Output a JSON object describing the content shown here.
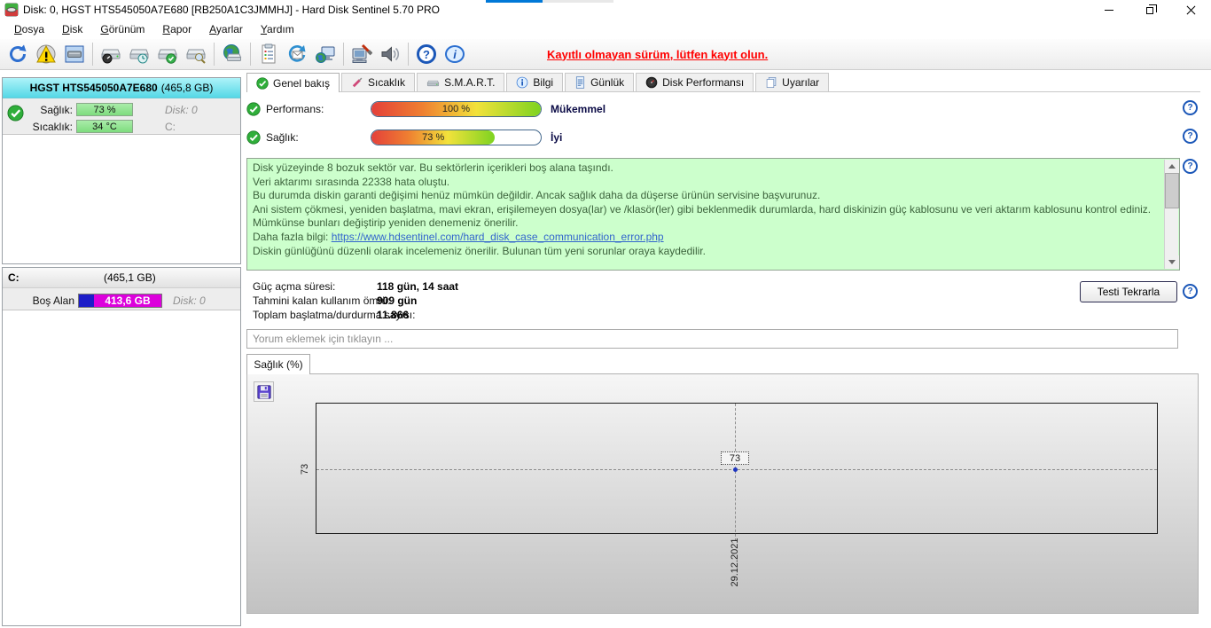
{
  "window": {
    "title": "Disk: 0, HGST HTS545050A7E680 [RB250A1C3JMMHJ]  -  Hard Disk Sentinel 5.70 PRO"
  },
  "menu": {
    "items": [
      "Dosya",
      "Disk",
      "Görünüm",
      "Rapor",
      "Ayarlar",
      "Yardım"
    ]
  },
  "toolbar": {
    "register_notice": "Kayıtlı olmayan sürüm, lütfen kayıt olun.",
    "icons": [
      "refresh",
      "warning-report",
      "disk-panel",
      "disk-gauge",
      "disk-clock",
      "disk-test",
      "disk-search",
      "web-disk",
      "report",
      "send-report",
      "network-remote",
      "remote-config",
      "sound",
      "help",
      "info"
    ]
  },
  "icons": {
    "help_glyph": "?",
    "info_glyph": "i"
  },
  "tabs": [
    {
      "label": "Genel bakış",
      "active": true
    },
    {
      "label": "Sıcaklık",
      "active": false
    },
    {
      "label": "S.M.A.R.T.",
      "active": false
    },
    {
      "label": "Bilgi",
      "active": false
    },
    {
      "label": "Günlük",
      "active": false
    },
    {
      "label": "Disk Performansı",
      "active": false
    },
    {
      "label": "Uyarılar",
      "active": false
    }
  ],
  "sidebar": {
    "disk": {
      "model": "HGST HTS545050A7E680",
      "size": "(465,8 GB)",
      "health_label": "Sağlık:",
      "health_value": "73 %",
      "health_percent": 73,
      "disk_label": "Disk: 0",
      "temp_label": "Sıcaklık:",
      "temp_value": "34 °C",
      "drive_label": "C:"
    },
    "partition": {
      "name": "C:",
      "size": "(465,1 GB)",
      "free_label": "Boş Alan",
      "free_value": "413,6 GB",
      "disk_label": "Disk: 0"
    }
  },
  "overview": {
    "performance": {
      "label": "Performans:",
      "value": "100 %",
      "percent": 100,
      "status": "Mükemmel"
    },
    "health": {
      "label": "Sağlık:",
      "value": "73 %",
      "percent": 73,
      "status": "İyi"
    },
    "message_lines": [
      "Disk yüzeyinde 8 bozuk sektör var. Bu sektörlerin içerikleri boş alana taşındı.",
      "Veri aktarımı sırasında 22338 hata oluştu.",
      "Bu durumda diskin garanti değişimi henüz mümkün değildir. Ancak sağlık daha da düşerse ürünün servisine başvurunuz.",
      "Ani sistem çökmesi, yeniden başlatma, mavi ekran, erişilemeyen dosya(lar) ve /klasör(ler) gibi beklenmedik durumlarda, hard diskinizin güç kablosunu ve veri aktarım kablosunu kontrol ediniz. Mümkünse bunları değiştirip yeniden denemeniz önerilir.",
      "Diskin günlüğünü düzenli olarak incelemeniz önerilir. Bulunan tüm yeni sorunlar oraya kaydedilir."
    ],
    "more_info_prefix": "Daha fazla bilgi: ",
    "more_info_link": "https://www.hdsentinel.com/hard_disk_case_communication_error.php",
    "stats": [
      {
        "label": "Güç açma süresi:",
        "value": "118 gün, 14 saat"
      },
      {
        "label": "Tahmini kalan kullanım ömrü:",
        "value": "909 gün"
      },
      {
        "label": "Toplam başlatma/durdurma sayısı:",
        "value": "11.866"
      }
    ],
    "retest_button": "Testi Tekrarla",
    "comment_placeholder": "Yorum eklemek için tıklayın ..."
  },
  "chart": {
    "tab_label": "Sağlık (%)"
  },
  "chart_data": {
    "type": "line",
    "title": "Sağlık (%)",
    "x": [
      "29.12.2021"
    ],
    "series": [
      {
        "name": "Sağlık (%)",
        "values": [
          73
        ]
      }
    ],
    "yticks": [
      "73"
    ],
    "point_labels": [
      "73"
    ],
    "ylim": [
      0,
      100
    ],
    "grid": "dashed crosshair at data point",
    "legend": "none"
  },
  "colors": {
    "notice_red": "#ff0000",
    "link_blue": "#3366cc",
    "health_bar_green": "#7edc7e",
    "free_space_magenta": "#dc00dc",
    "free_space_blue": "#1d1dc8",
    "selected_disk_cyan": "#55d8e6",
    "message_bg_green": "#ccffcc"
  }
}
